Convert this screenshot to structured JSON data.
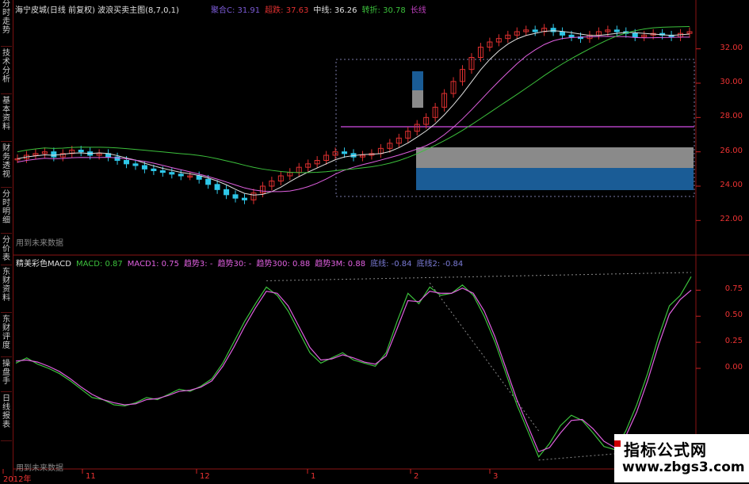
{
  "left_tabs": [
    "分时走势",
    "技术分析",
    "基本资料",
    "财务透视",
    "分时明细",
    "分价表",
    "东财资料",
    "东财评度",
    "操盘手",
    "日线报表"
  ],
  "top_panel": {
    "title": "海宁皮城(日线 前复权) 波浪买卖主图(8,7,0,1)",
    "legend": [
      {
        "text": "聚合C: 31.91",
        "color": "#7b5bd6"
      },
      {
        "text": "超跌: 37.63",
        "color": "#e03030"
      },
      {
        "text": "中线: 36.26",
        "color": "#e0e0e0"
      },
      {
        "text": "转折: 30.78",
        "color": "#3cc13c"
      },
      {
        "text": "长线",
        "color": "#c040c0"
      }
    ],
    "no_future": "用到未来数据",
    "y_ticks": [
      "32.00",
      "30.00",
      "28.00",
      "26.00",
      "24.00",
      "22.00"
    ]
  },
  "bottom_panel": {
    "legend": [
      {
        "text": "精美彩色MACD",
        "color": "#e0e0e0"
      },
      {
        "text": "MACD: 0.87",
        "color": "#3cc13c"
      },
      {
        "text": "MACD1: 0.75",
        "color": "#e060e0"
      },
      {
        "text": "趋势3: -",
        "color": "#e060e0"
      },
      {
        "text": "趋势30: -",
        "color": "#e060e0"
      },
      {
        "text": "趋势300: 0.88",
        "color": "#e060e0"
      },
      {
        "text": "趋势3M: 0.88",
        "color": "#e060e0"
      },
      {
        "text": "底线: -0.84",
        "color": "#7b7bd6"
      },
      {
        "text": "底线2: -0.84",
        "color": "#7b7bd6"
      }
    ],
    "no_future": "用到未来数据",
    "y_ticks": [
      "0.75",
      "0.50",
      "0.25",
      "0.00"
    ]
  },
  "x_ticks": [
    "2012年",
    "11",
    "12",
    "1",
    "2",
    "3"
  ],
  "watermark": {
    "title": "指标公式网",
    "url": "www.zbgs3.com"
  },
  "chart_data": [
    {
      "type": "candlestick",
      "title": "海宁皮城(日线 前复权) 波浪买卖主图(8,7,0,1)",
      "y_ticks": [
        32,
        30,
        28,
        26,
        24,
        22
      ],
      "ylim": [
        21,
        33
      ],
      "close": [
        25.6,
        25.8,
        25.9,
        26.0,
        25.7,
        25.9,
        26.1,
        26.0,
        25.8,
        25.9,
        25.7,
        25.5,
        25.3,
        25.2,
        25.0,
        24.9,
        24.8,
        24.7,
        24.6,
        24.6,
        24.4,
        24.1,
        23.8,
        23.5,
        23.3,
        23.2,
        23.6,
        24.0,
        24.3,
        24.6,
        24.8,
        25.1,
        25.3,
        25.5,
        25.8,
        26.0,
        25.9,
        25.7,
        25.8,
        25.9,
        26.2,
        26.5,
        26.8,
        27.2,
        27.6,
        28.0,
        28.6,
        29.4,
        30.1,
        30.8,
        31.5,
        32.1,
        32.4,
        32.6,
        32.8,
        33.0,
        33.1,
        33.0,
        33.2,
        33.0,
        32.8,
        32.7,
        32.6,
        32.8,
        33.0,
        33.1,
        33.0,
        32.9,
        32.7,
        32.8,
        32.9,
        32.8,
        32.7,
        32.9,
        33.0
      ]
    },
    {
      "type": "line",
      "title": "精美彩色MACD",
      "y_ticks": [
        0.75,
        0.5,
        0.25,
        0.0
      ],
      "ylim": [
        -0.95,
        0.95
      ],
      "series": [
        {
          "name": "MACD",
          "color": "#3cc13c",
          "values": [
            0.05,
            0.1,
            0.04,
            0.0,
            -0.05,
            -0.12,
            -0.2,
            -0.28,
            -0.3,
            -0.35,
            -0.36,
            -0.33,
            -0.28,
            -0.3,
            -0.25,
            -0.2,
            -0.22,
            -0.17,
            -0.1,
            0.05,
            0.25,
            0.45,
            0.62,
            0.78,
            0.7,
            0.55,
            0.35,
            0.15,
            0.05,
            0.1,
            0.15,
            0.08,
            0.05,
            0.02,
            0.15,
            0.45,
            0.72,
            0.62,
            0.78,
            0.7,
            0.72,
            0.8,
            0.7,
            0.5,
            0.25,
            -0.05,
            -0.35,
            -0.6,
            -0.85,
            -0.72,
            -0.55,
            -0.45,
            -0.5,
            -0.62,
            -0.75,
            -0.78,
            -0.6,
            -0.35,
            -0.05,
            0.3,
            0.6,
            0.7,
            0.88
          ]
        },
        {
          "name": "MACD1",
          "color": "#e060e0",
          "values": [
            0.07,
            0.08,
            0.06,
            0.02,
            -0.03,
            -0.1,
            -0.18,
            -0.25,
            -0.3,
            -0.33,
            -0.35,
            -0.34,
            -0.3,
            -0.29,
            -0.26,
            -0.22,
            -0.21,
            -0.18,
            -0.12,
            0.02,
            0.2,
            0.4,
            0.58,
            0.74,
            0.72,
            0.6,
            0.4,
            0.2,
            0.08,
            0.09,
            0.13,
            0.1,
            0.06,
            0.04,
            0.12,
            0.38,
            0.65,
            0.64,
            0.74,
            0.72,
            0.72,
            0.77,
            0.72,
            0.55,
            0.3,
            0.0,
            -0.3,
            -0.55,
            -0.8,
            -0.76,
            -0.62,
            -0.5,
            -0.49,
            -0.58,
            -0.7,
            -0.76,
            -0.65,
            -0.42,
            -0.12,
            0.22,
            0.52,
            0.66,
            0.75
          ]
        }
      ]
    }
  ]
}
